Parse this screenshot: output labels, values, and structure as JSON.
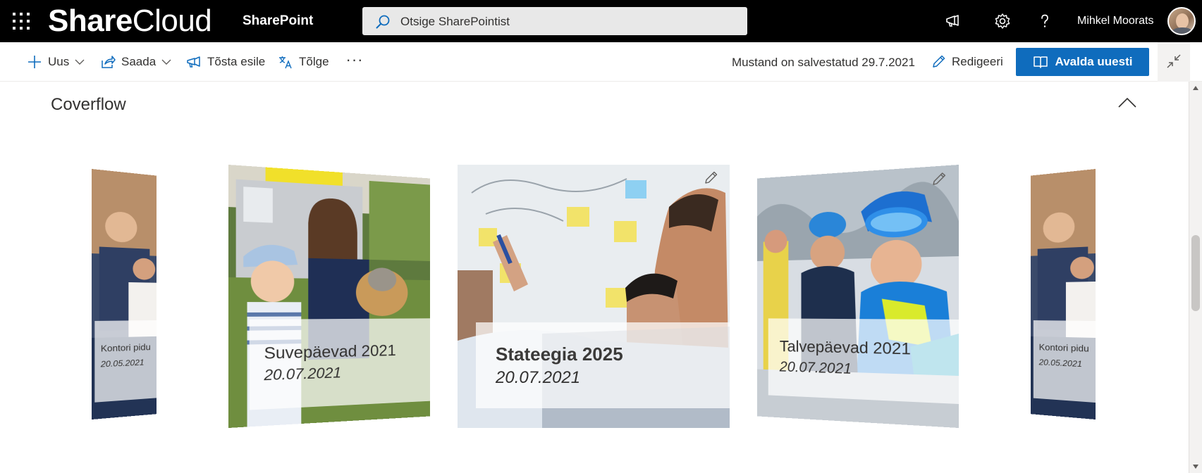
{
  "suite": {
    "brand_bold": "Share",
    "brand_light": "Cloud",
    "app_name": "SharePoint",
    "search_placeholder": "Otsige SharePointist",
    "user_name": "Mihkel Moorats"
  },
  "commands": {
    "new": "Uus",
    "send": "Saada",
    "promote": "Tõsta esile",
    "translate": "Tõlge",
    "more": "···",
    "draft_status": "Mustand on salvestatud 29.7.2021",
    "edit": "Redigeeri",
    "republish": "Avalda uuesti"
  },
  "section": {
    "title": "Coverflow"
  },
  "cards": [
    {
      "title": "Kontori pidu",
      "date": "20.05.2021"
    },
    {
      "title": "Suvepäevad 2021",
      "date": "20.07.2021"
    },
    {
      "title": "Stateegia 2025",
      "date": "20.07.2021"
    },
    {
      "title": "Talvepäevad 2021",
      "date": "20.07.2021"
    },
    {
      "title": "Kontori pidu",
      "date": "20.05.2021"
    }
  ],
  "colors": {
    "suitebar": "#000000",
    "accent": "#0f6cbd",
    "text": "#323130"
  }
}
